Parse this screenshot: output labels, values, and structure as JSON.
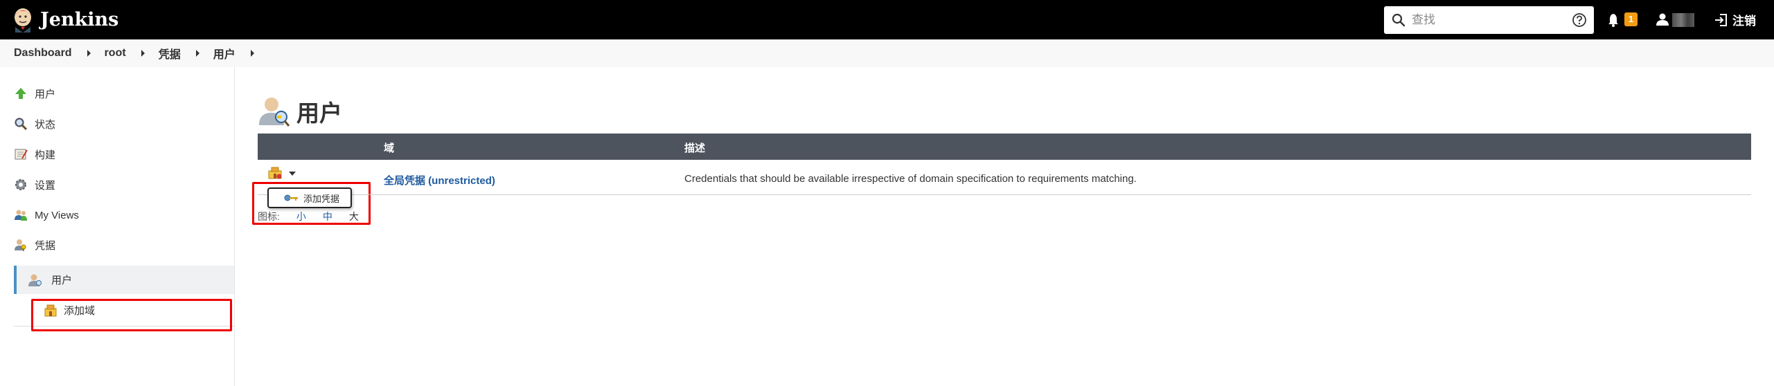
{
  "app": {
    "name": "Jenkins"
  },
  "search": {
    "placeholder": "查找"
  },
  "notifications": {
    "count": "1"
  },
  "header": {
    "logout_label": "注销"
  },
  "breadcrumb": [
    "Dashboard",
    "root",
    "凭据",
    "用户"
  ],
  "sidebar": {
    "items": [
      {
        "label": "用户",
        "icon": "up-arrow-icon"
      },
      {
        "label": "状态",
        "icon": "magnifier-icon"
      },
      {
        "label": "构建",
        "icon": "notepad-icon"
      },
      {
        "label": "设置",
        "icon": "gear-icon"
      },
      {
        "label": "My Views",
        "icon": "users-icon"
      },
      {
        "label": "凭据",
        "icon": "credentials-icon"
      }
    ],
    "active_sub": {
      "label": "用户"
    },
    "add_domain": {
      "label": "添加域"
    }
  },
  "main": {
    "title": "用户",
    "table": {
      "columns": [
        "域",
        "描述"
      ],
      "rows": [
        {
          "domain": "全局凭据 (unrestricted)",
          "description": "Credentials that should be available irrespective of domain specification to requirements matching."
        }
      ]
    },
    "popup": {
      "label": "添加凭据"
    },
    "icon_size": {
      "label": "图标:",
      "options": [
        "小",
        "中",
        "大"
      ]
    }
  },
  "colors": {
    "topbar": "#000000",
    "table_header": "#4d545d",
    "link": "#1e5a9e",
    "badge": "#f39c12",
    "highlight": "#e00000"
  }
}
